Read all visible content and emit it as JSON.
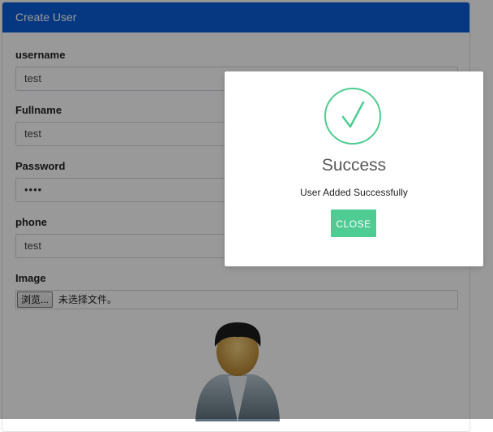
{
  "form": {
    "title": "Create User",
    "fields": [
      {
        "label": "username",
        "value": "test"
      },
      {
        "label": "Fullname",
        "value": "test"
      },
      {
        "label": "Password",
        "value": "••••"
      },
      {
        "label": "phone",
        "value": "test"
      }
    ],
    "image": {
      "label": "Image",
      "browse_label": "浏览...",
      "file_status": "未选择文件。"
    }
  },
  "modal": {
    "title": "Success",
    "message": "User Added Successfully",
    "close_label": "CLOSE",
    "accent_color": "#4ecc93"
  },
  "colors": {
    "header": "#0b5ed7",
    "success": "#4ecc93"
  },
  "icons": {
    "success": "check-circle-icon",
    "avatar": "user-avatar-icon"
  }
}
